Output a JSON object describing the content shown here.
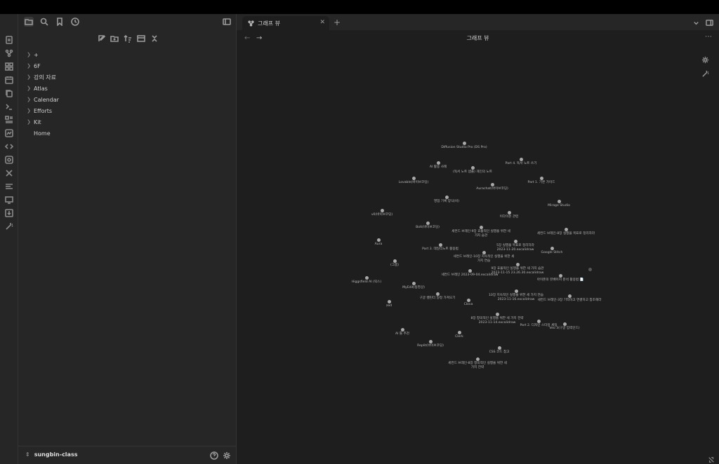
{
  "ribbon": {
    "icons": [
      "new-note-icon",
      "graph-icon",
      "canvas-icon",
      "calendar-icon",
      "copy-icon",
      "terminal-icon",
      "kanban-icon",
      "excalidraw-icon",
      "templater-icon",
      "sync-icon",
      "tools-icon",
      "outline-icon",
      "slides-icon",
      "import-icon",
      "magic-wand-icon"
    ]
  },
  "sidebar": {
    "tree": [
      {
        "label": "+",
        "folder": true
      },
      {
        "label": "6F",
        "folder": true
      },
      {
        "label": "강의 자료",
        "folder": true
      },
      {
        "label": "Atlas",
        "folder": true
      },
      {
        "label": "Calendar",
        "folder": true
      },
      {
        "label": "Efforts",
        "folder": true
      },
      {
        "label": "Kit",
        "folder": true
      },
      {
        "label": "Home",
        "folder": false
      }
    ],
    "vault_name": "sungbin-class"
  },
  "tab": {
    "title": "그래프 뷰"
  },
  "view": {
    "title": "그래프 뷰"
  },
  "graph": {
    "nodes": [
      {
        "label": "Diffusion Studio Pro (DS Pro)"
      },
      {
        "label": "Part 4. 독서 노트 쓰기"
      },
      {
        "label": "AI 활용 사례"
      },
      {
        "label": "(독서 노트 샘플) 개인의 노트"
      },
      {
        "label": "Lovable(바이브코딩)"
      },
      {
        "label": "Part 1. 기본 가이드"
      },
      {
        "label": "Aurachat(바이브코딩)"
      },
      {
        "label": "Mirage Studio"
      },
      {
        "label": "영업 기록 양식(비)"
      },
      {
        "label": "v0(바이브코딩)"
      },
      {
        "label": "이다이온 관련"
      },
      {
        "label": "Bolt(바이브코딩)"
      },
      {
        "label": "세컨드 브레인-9장 효율적인 실행을 위한 세\n가지 습관"
      },
      {
        "label": "세컨드 브레인-8장 실행을 목표로 정리하라"
      },
      {
        "label": "Aura"
      },
      {
        "label": "Part 3. 데일리노트 활용법"
      },
      {
        "label": "5장 실행을 목표로 정리하라\n2023-11-20.excalidraw"
      },
      {
        "label": "Google Stitch"
      },
      {
        "label": "세컨드 브레인-10장 지속적인 실행을 위한 세\n가지 연습"
      },
      {
        "label": "(그룹)"
      },
      {
        "label": "9장 효율적인 실행을 위한 세 가지 습관\n2023-11-15 23.26.30.excalidraw"
      },
      {
        "label": "세컨드 브레인 2023-09-04.excalidraw"
      },
      {
        "label": "아이폰의 뮤배이지 분석 활용법 📄"
      },
      {
        "label": "Higgsfield AI (릭스)"
      },
      {
        "label": "MyEdit(동영상)"
      },
      {
        "label": "구글 캘린더 일정 가져오기"
      },
      {
        "label": "10장 지속적인 실행을 위한 세 가지 연습\n2023-11-16.excalidraw"
      },
      {
        "label": "세컨드 브레인-3장 기억하고 연결하고 참조해라"
      },
      {
        "label": "zed"
      },
      {
        "label": "Clova"
      },
      {
        "label": "8장 창의적인 실행을 위한 세 가지 전략\n2023-11-14.excalidraw"
      },
      {
        "label": "Part 2. 디자인 스타일 세팅"
      },
      {
        "label": "Veo 3(구글 입력인드)"
      },
      {
        "label": "AI 툴 추천"
      },
      {
        "label": "Clerk"
      },
      {
        "label": "Replit(바이브코딩)"
      },
      {
        "label": "CSS 코드 참고"
      },
      {
        "label": "세컨드 브레인-8장 창의적인 실행을 위한 세\n가지 전략"
      },
      {
        "label": ""
      }
    ]
  }
}
